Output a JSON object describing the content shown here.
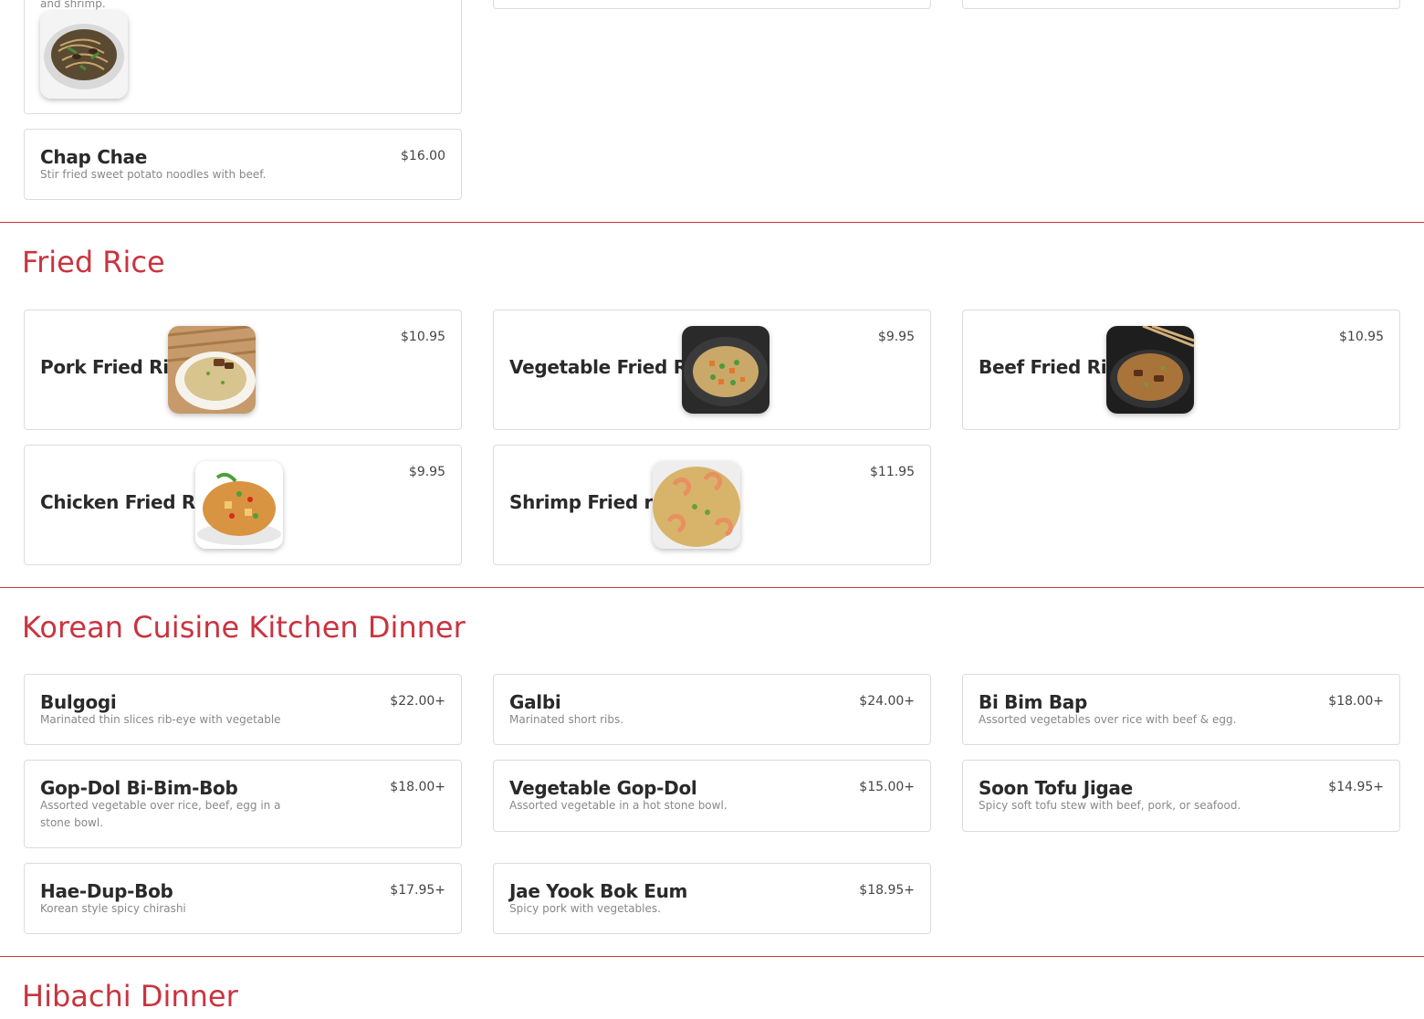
{
  "accent_color": "#c9343f",
  "top_partial": {
    "desc_fragment": "and shrimp.",
    "chap_chae": {
      "name": "Chap Chae",
      "price": "$16.00",
      "desc": "Stir fried sweet potato noodles with beef."
    }
  },
  "sections": {
    "fried_rice": {
      "title": "Fried Rice",
      "items": [
        {
          "name": "Pork Fried Rice",
          "price": "$10.95",
          "image": "pork-fried-rice-photo"
        },
        {
          "name": "Vegetable Fried Rice",
          "price": "$9.95",
          "image": "vegetable-fried-rice-photo"
        },
        {
          "name": "Beef Fried Rice",
          "price": "$10.95",
          "image": "beef-fried-rice-photo"
        },
        {
          "name": "Chicken Fried Rice",
          "price": "$9.95",
          "image": "chicken-fried-rice-photo"
        },
        {
          "name": "Shrimp Fried rice",
          "price": "$11.95",
          "image": "shrimp-fried-rice-photo"
        }
      ]
    },
    "korean": {
      "title": "Korean Cuisine Kitchen Dinner",
      "items": [
        {
          "name": "Bulgogi",
          "price": "$22.00+",
          "desc": "Marinated thin slices rib-eye with vegetable"
        },
        {
          "name": "Galbi",
          "price": "$24.00+",
          "desc": "Marinated short ribs."
        },
        {
          "name": "Bi Bim Bap",
          "price": "$18.00+",
          "desc": "Assorted vegetables over rice with beef & egg."
        },
        {
          "name": "Gop-Dol Bi-Bim-Bob",
          "price": "$18.00+",
          "desc": "Assorted vegetable over rice, beef, egg in a stone bowl."
        },
        {
          "name": "Vegetable Gop-Dol",
          "price": "$15.00+",
          "desc": "Assorted vegetable in a hot stone bowl."
        },
        {
          "name": "Soon Tofu Jigae",
          "price": "$14.95+",
          "desc": "Spicy soft tofu stew with beef, pork, or seafood."
        },
        {
          "name": "Hae-Dup-Bob",
          "price": "$17.95+",
          "desc": "Korean style spicy chirashi"
        },
        {
          "name": "Jae Yook Bok Eum",
          "price": "$18.95+",
          "desc": "Spicy pork with vegetables."
        }
      ]
    },
    "hibachi": {
      "title": "Hibachi Dinner"
    }
  }
}
